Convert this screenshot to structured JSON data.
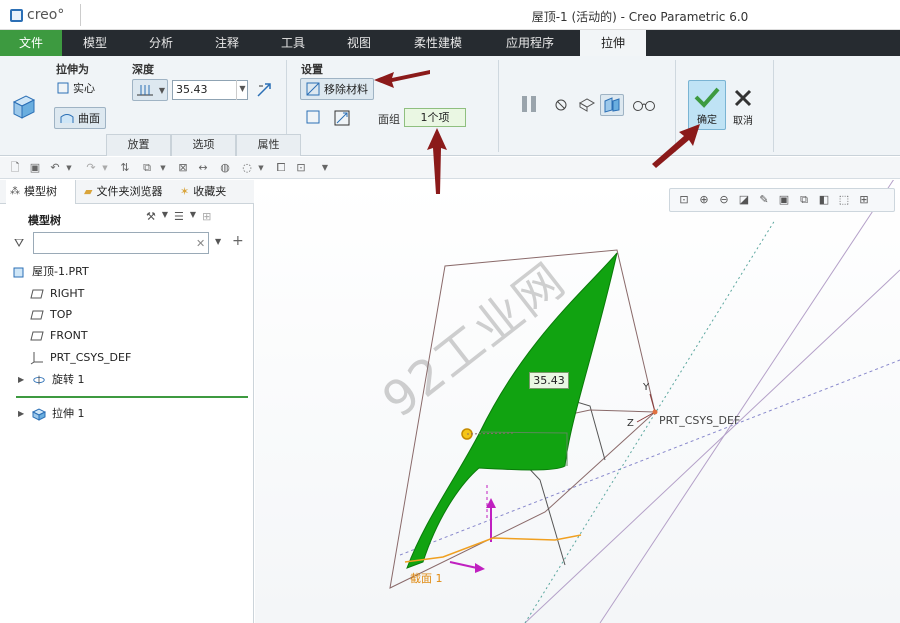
{
  "app": {
    "logo_text": "creo°",
    "window_title": "屋顶-1 (活动的) - Creo Parametric 6.0"
  },
  "menu": {
    "file": "文件",
    "items": [
      "模型",
      "分析",
      "注释",
      "工具",
      "视图",
      "柔性建模",
      "应用程序"
    ],
    "active_tab": "拉伸"
  },
  "ribbon": {
    "extrude_as_label": "拉伸为",
    "solid_label": "实心",
    "surface_label": "曲面",
    "depth_label": "深度",
    "depth_value": "35.43",
    "settings_label": "设置",
    "remove_material_label": "移除材料",
    "quilt_label": "面组",
    "quilt_value": "1个项",
    "subtabs": [
      "放置",
      "选项",
      "属性"
    ],
    "ok_label": "确定",
    "cancel_label": "取消",
    "colors": {
      "ok_check": "#3d9a40",
      "surface_green": "#11a311",
      "file_tab": "#3d9a40"
    }
  },
  "panel": {
    "tabs": [
      "模型树",
      "文件夹浏览器",
      "收藏夹"
    ],
    "tree_header": "模型树",
    "search_placeholder": "",
    "tree": {
      "root": "屋顶-1.PRT",
      "right": "RIGHT",
      "top": "TOP",
      "front": "FRONT",
      "csys": "PRT_CSYS_DEF",
      "revolve": "旋转 1",
      "extrude": "拉伸 1"
    }
  },
  "viewport": {
    "dimension_value": "35.43",
    "csys_label": "PRT_CSYS_DEF",
    "axis_y": "Y",
    "axis_z": "Z",
    "sketch_label": "截面 1",
    "watermark": "92工业网"
  }
}
